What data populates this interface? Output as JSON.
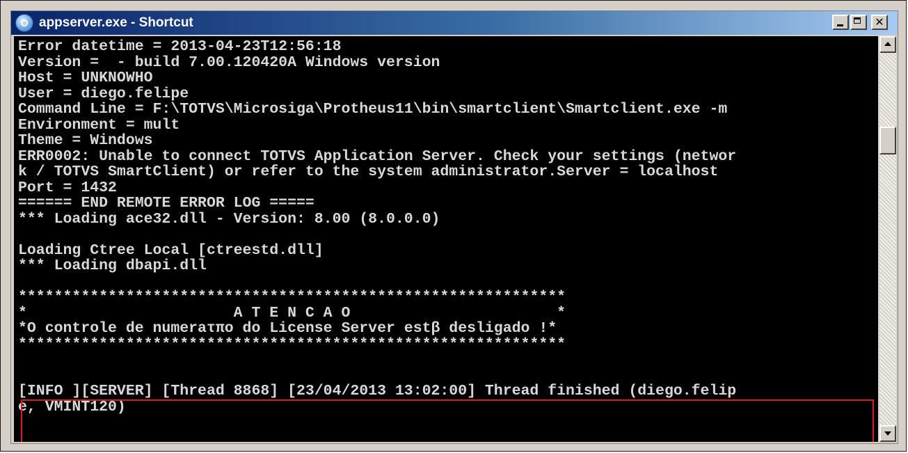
{
  "window": {
    "title": "appserver.exe - Shortcut",
    "icon": "app-icon",
    "controls": {
      "minimize_icon": "minimize-icon",
      "maximize_icon": "maximize-icon",
      "close_icon": "close-icon",
      "close_glyph": "✕"
    }
  },
  "console": {
    "lines": [
      "Error datetime = 2013-04-23T12:56:18",
      "Version =  - build 7.00.120420A Windows version",
      "Host = UNKNOWHO",
      "User = diego.felipe",
      "Command Line = F:\\TOTVS\\Microsiga\\Protheus11\\bin\\smartclient\\Smartclient.exe -m",
      "Environment = mult",
      "Theme = Windows",
      "ERR0002: Unable to connect TOTVS Application Server. Check your settings (networ",
      "k / TOTVS SmartClient) or refer to the system administrator.Server = localhost",
      "Port = 1432",
      "====== END REMOTE ERROR LOG =====",
      "*** Loading ace32.dll - Version: 8.00 (8.0.0.0)",
      "",
      "Loading Ctree Local [ctreestd.dll]",
      "*** Loading dbapi.dll",
      "",
      "*************************************************************",
      "*                       A T E N C A O                       *",
      "*O controle de numeraτπo do License Server estβ desligado !*",
      "*************************************************************",
      "",
      "",
      "[INFO ][SERVER] [Thread 8868] [23/04/2013 13:02:00] Thread finished (diego.felip",
      "e, VMINT120)"
    ],
    "text_color": "#d8d8d8",
    "background": "#000000",
    "highlight_color": "#d81e1e"
  },
  "scrollbar": {
    "up_icon": "scroll-up-arrow-icon",
    "down_icon": "scroll-down-arrow-icon"
  }
}
